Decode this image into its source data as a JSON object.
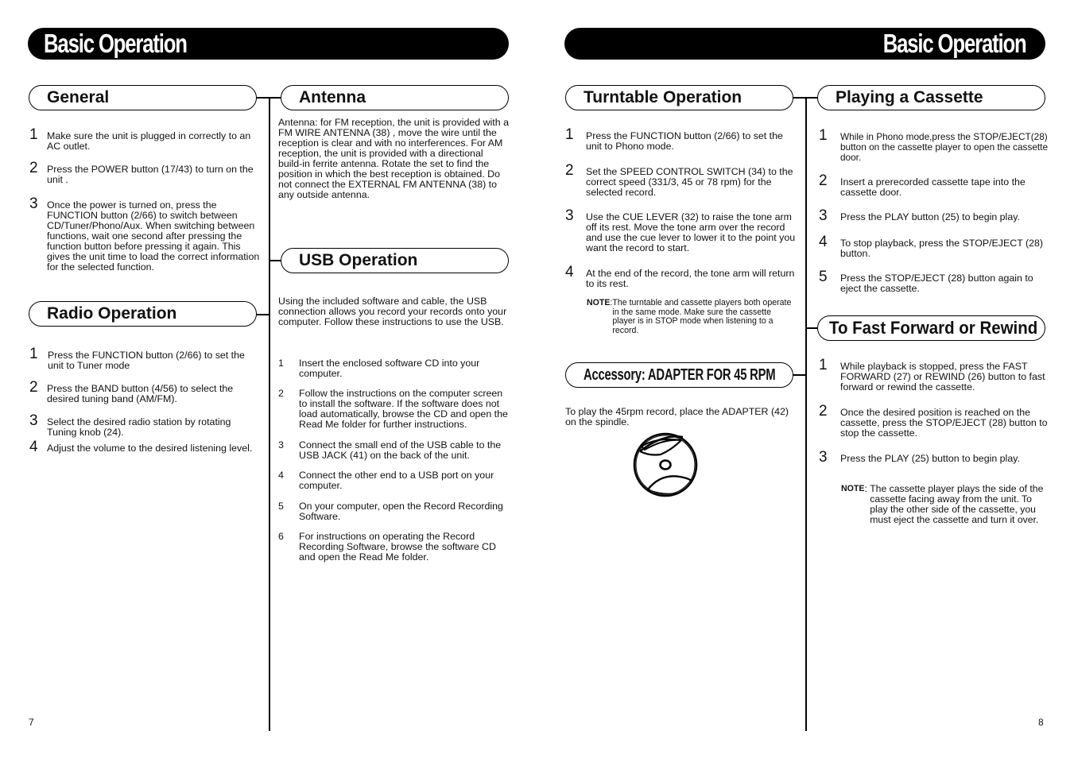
{
  "left_page": {
    "banner_title": "Basic Operation",
    "page_number": "7",
    "general": {
      "heading": "General",
      "steps": [
        {
          "num": "1",
          "text": "Make sure the unit is plugged in correctly to an AC outlet."
        },
        {
          "num": "2",
          "text": "Press the POWER button (17/43) to turn on the unit ."
        },
        {
          "num": "3",
          "text": "Once the power is turned on, press the FUNCTION button (2/66) to switch between CD/Tuner/Phono/Aux. When switching between functions, wait one second after pressing the function button before pressing it again. This gives the unit time to load the correct information for the selected function."
        }
      ]
    },
    "radio": {
      "heading": "Radio Operation",
      "steps": [
        {
          "num": "1",
          "text": "Press the FUNCTION button (2/66) to set the unit to Tuner mode"
        },
        {
          "num": "2",
          "text": "Press the BAND button (4/56) to select the desired tuning band (AM/FM)."
        },
        {
          "num": "3",
          "text": "Select the desired radio station by rotating Tuning knob (24)."
        },
        {
          "num": "4",
          "text": "Adjust the volume to the desired listening level."
        }
      ]
    },
    "antenna": {
      "heading": "Antenna",
      "text": "Antenna: for FM reception, the unit is provided with a FM WIRE ANTENNA (38) , move the wire until the reception is clear and with no interferences. For AM reception, the unit is provided with a directional build-in ferrite antenna. Rotate the set to find the position in which the best reception is obtained. Do not connect the EXTERNAL FM ANTENNA (38) to any outside antenna."
    },
    "usb": {
      "heading": "USB Operation",
      "intro": "Using the included software and cable, the USB connection allows you record your records onto your computer. Follow these instructions to use the USB.",
      "steps": [
        {
          "num": "1",
          "text": "Insert the enclosed software CD into your computer."
        },
        {
          "num": "2",
          "text": "Follow the instructions on the computer screen to install the software. If the software does not load automatically, browse the CD and open the Read Me folder for further instructions."
        },
        {
          "num": "3",
          "text": "Connect the small end of the USB cable to the USB JACK (41) on the back of the unit."
        },
        {
          "num": "4",
          "text": "Connect the other end to a USB port on your computer."
        },
        {
          "num": "5",
          "text": "On your computer, open the Record Recording Software."
        },
        {
          "num": "6",
          "text": "For instructions on operating the Record Recording Software, browse the software CD and open the Read Me folder."
        }
      ]
    }
  },
  "right_page": {
    "banner_title": "Basic Operation",
    "page_number": "8",
    "turntable": {
      "heading": "Turntable Operation",
      "steps": [
        {
          "num": "1",
          "text": "Press the FUNCTION button (2/66) to set the unit to Phono mode."
        },
        {
          "num": "2",
          "text": "Set the SPEED CONTROL SWITCH (34) to the correct speed (331/3, 45 or 78 rpm) for the selected record."
        },
        {
          "num": "3",
          "text": "Use the CUE LEVER (32) to raise the tone arm off its rest. Move the tone arm over the record and use the cue lever to lower it to the point you want the record to start."
        },
        {
          "num": "4",
          "text": "At the end of the record, the tone arm will return to its rest."
        }
      ],
      "note_label": "NOTE",
      "note_text": "The turntable and cassette players both operate in the same mode. Make sure the cassette player is in STOP mode when listening to a record."
    },
    "accessory": {
      "heading": "Accessory:  ADAPTER FOR 45 RPM",
      "text": "To play the 45rpm record, place the ADAPTER (42) on the spindle.",
      "illustration": "45-rpm-adapter-icon"
    },
    "cassette": {
      "heading": "Playing a Cassette",
      "steps": [
        {
          "num": "1",
          "text": "While in Phono mode,press the STOP/EJECT(28) button on the cassette player to open the cassette door."
        },
        {
          "num": "2",
          "text": "Insert a prerecorded cassette tape into the cassette door."
        },
        {
          "num": "3",
          "text": "Press the PLAY button (25) to begin play."
        },
        {
          "num": "4",
          "text": "To stop playback, press the STOP/EJECT (28) button."
        },
        {
          "num": "5",
          "text": "Press the STOP/EJECT (28) button again to eject the cassette."
        }
      ]
    },
    "fastforward": {
      "heading": "To Fast Forward or Rewind",
      "steps": [
        {
          "num": "1",
          "text": "While playback is stopped, press the FAST FORWARD (27) or REWIND (26) button to fast forward or rewind the cassette."
        },
        {
          "num": "2",
          "text": "Once the desired position is reached on the cassette, press the STOP/EJECT (28) button to stop the cassette."
        },
        {
          "num": "3",
          "text": "Press the PLAY (25) button to begin play."
        }
      ],
      "note_label": "NOTE",
      "note_text": "The cassette player plays the side of the cassette facing away from the unit. To play the other side of the cassette, you must eject the cassette and turn it over."
    }
  }
}
